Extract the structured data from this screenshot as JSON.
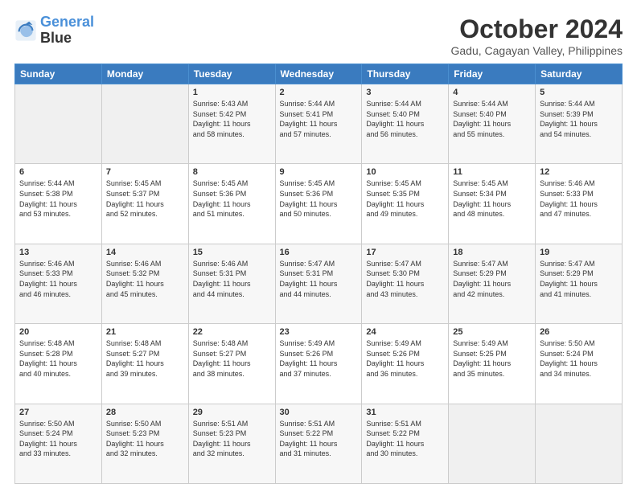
{
  "logo": {
    "line1": "General",
    "line2": "Blue"
  },
  "title": "October 2024",
  "location": "Gadu, Cagayan Valley, Philippines",
  "days_of_week": [
    "Sunday",
    "Monday",
    "Tuesday",
    "Wednesday",
    "Thursday",
    "Friday",
    "Saturday"
  ],
  "weeks": [
    [
      {
        "num": "",
        "info": ""
      },
      {
        "num": "",
        "info": ""
      },
      {
        "num": "1",
        "info": "Sunrise: 5:43 AM\nSunset: 5:42 PM\nDaylight: 11 hours\nand 58 minutes."
      },
      {
        "num": "2",
        "info": "Sunrise: 5:44 AM\nSunset: 5:41 PM\nDaylight: 11 hours\nand 57 minutes."
      },
      {
        "num": "3",
        "info": "Sunrise: 5:44 AM\nSunset: 5:40 PM\nDaylight: 11 hours\nand 56 minutes."
      },
      {
        "num": "4",
        "info": "Sunrise: 5:44 AM\nSunset: 5:40 PM\nDaylight: 11 hours\nand 55 minutes."
      },
      {
        "num": "5",
        "info": "Sunrise: 5:44 AM\nSunset: 5:39 PM\nDaylight: 11 hours\nand 54 minutes."
      }
    ],
    [
      {
        "num": "6",
        "info": "Sunrise: 5:44 AM\nSunset: 5:38 PM\nDaylight: 11 hours\nand 53 minutes."
      },
      {
        "num": "7",
        "info": "Sunrise: 5:45 AM\nSunset: 5:37 PM\nDaylight: 11 hours\nand 52 minutes."
      },
      {
        "num": "8",
        "info": "Sunrise: 5:45 AM\nSunset: 5:36 PM\nDaylight: 11 hours\nand 51 minutes."
      },
      {
        "num": "9",
        "info": "Sunrise: 5:45 AM\nSunset: 5:36 PM\nDaylight: 11 hours\nand 50 minutes."
      },
      {
        "num": "10",
        "info": "Sunrise: 5:45 AM\nSunset: 5:35 PM\nDaylight: 11 hours\nand 49 minutes."
      },
      {
        "num": "11",
        "info": "Sunrise: 5:45 AM\nSunset: 5:34 PM\nDaylight: 11 hours\nand 48 minutes."
      },
      {
        "num": "12",
        "info": "Sunrise: 5:46 AM\nSunset: 5:33 PM\nDaylight: 11 hours\nand 47 minutes."
      }
    ],
    [
      {
        "num": "13",
        "info": "Sunrise: 5:46 AM\nSunset: 5:33 PM\nDaylight: 11 hours\nand 46 minutes."
      },
      {
        "num": "14",
        "info": "Sunrise: 5:46 AM\nSunset: 5:32 PM\nDaylight: 11 hours\nand 45 minutes."
      },
      {
        "num": "15",
        "info": "Sunrise: 5:46 AM\nSunset: 5:31 PM\nDaylight: 11 hours\nand 44 minutes."
      },
      {
        "num": "16",
        "info": "Sunrise: 5:47 AM\nSunset: 5:31 PM\nDaylight: 11 hours\nand 44 minutes."
      },
      {
        "num": "17",
        "info": "Sunrise: 5:47 AM\nSunset: 5:30 PM\nDaylight: 11 hours\nand 43 minutes."
      },
      {
        "num": "18",
        "info": "Sunrise: 5:47 AM\nSunset: 5:29 PM\nDaylight: 11 hours\nand 42 minutes."
      },
      {
        "num": "19",
        "info": "Sunrise: 5:47 AM\nSunset: 5:29 PM\nDaylight: 11 hours\nand 41 minutes."
      }
    ],
    [
      {
        "num": "20",
        "info": "Sunrise: 5:48 AM\nSunset: 5:28 PM\nDaylight: 11 hours\nand 40 minutes."
      },
      {
        "num": "21",
        "info": "Sunrise: 5:48 AM\nSunset: 5:27 PM\nDaylight: 11 hours\nand 39 minutes."
      },
      {
        "num": "22",
        "info": "Sunrise: 5:48 AM\nSunset: 5:27 PM\nDaylight: 11 hours\nand 38 minutes."
      },
      {
        "num": "23",
        "info": "Sunrise: 5:49 AM\nSunset: 5:26 PM\nDaylight: 11 hours\nand 37 minutes."
      },
      {
        "num": "24",
        "info": "Sunrise: 5:49 AM\nSunset: 5:26 PM\nDaylight: 11 hours\nand 36 minutes."
      },
      {
        "num": "25",
        "info": "Sunrise: 5:49 AM\nSunset: 5:25 PM\nDaylight: 11 hours\nand 35 minutes."
      },
      {
        "num": "26",
        "info": "Sunrise: 5:50 AM\nSunset: 5:24 PM\nDaylight: 11 hours\nand 34 minutes."
      }
    ],
    [
      {
        "num": "27",
        "info": "Sunrise: 5:50 AM\nSunset: 5:24 PM\nDaylight: 11 hours\nand 33 minutes."
      },
      {
        "num": "28",
        "info": "Sunrise: 5:50 AM\nSunset: 5:23 PM\nDaylight: 11 hours\nand 32 minutes."
      },
      {
        "num": "29",
        "info": "Sunrise: 5:51 AM\nSunset: 5:23 PM\nDaylight: 11 hours\nand 32 minutes."
      },
      {
        "num": "30",
        "info": "Sunrise: 5:51 AM\nSunset: 5:22 PM\nDaylight: 11 hours\nand 31 minutes."
      },
      {
        "num": "31",
        "info": "Sunrise: 5:51 AM\nSunset: 5:22 PM\nDaylight: 11 hours\nand 30 minutes."
      },
      {
        "num": "",
        "info": ""
      },
      {
        "num": "",
        "info": ""
      }
    ]
  ]
}
